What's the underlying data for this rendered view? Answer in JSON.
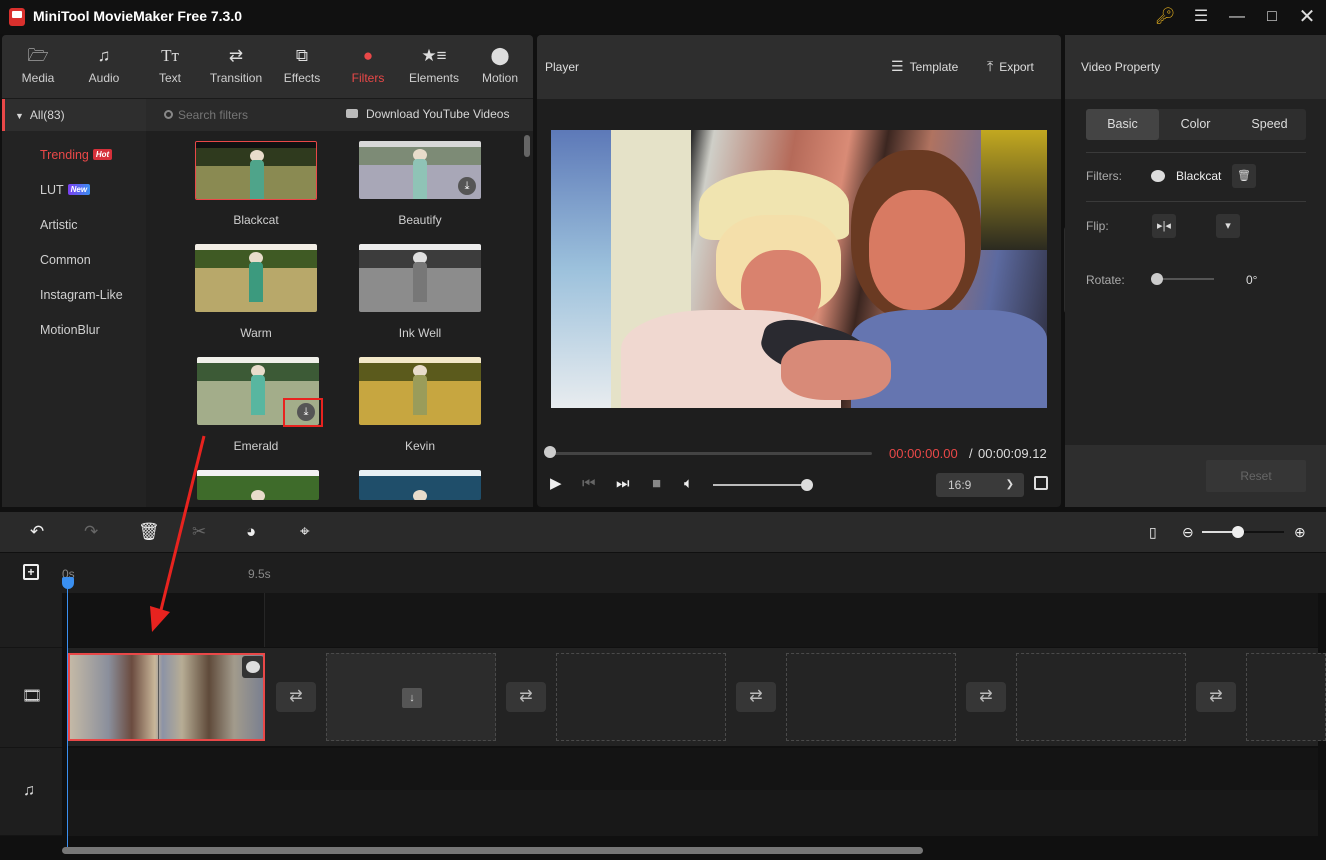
{
  "window": {
    "title": "MiniTool MovieMaker Free 7.3.0",
    "controls": [
      "key-icon",
      "menu-icon",
      "minimize-icon",
      "maximize-icon",
      "close-icon"
    ]
  },
  "main_tabs": [
    {
      "label": "Media",
      "icon": "folder-icon"
    },
    {
      "label": "Audio",
      "icon": "music-note-icon"
    },
    {
      "label": "Text",
      "icon": "text-icon"
    },
    {
      "label": "Transition",
      "icon": "transition-arrows-icon"
    },
    {
      "label": "Effects",
      "icon": "effects-icon"
    },
    {
      "label": "Filters",
      "icon": "filters-icon",
      "active": true
    },
    {
      "label": "Elements",
      "icon": "elements-icon"
    },
    {
      "label": "Motion",
      "icon": "motion-icon"
    }
  ],
  "categories": {
    "all_label": "All(83)",
    "items": [
      {
        "label": "Trending",
        "badge": "Hot",
        "active": true
      },
      {
        "label": "LUT",
        "badge": "New"
      },
      {
        "label": "Artistic"
      },
      {
        "label": "Common"
      },
      {
        "label": "Instagram-Like"
      },
      {
        "label": "MotionBlur"
      }
    ]
  },
  "filter_search": {
    "placeholder": "Search filters",
    "download_youtube_label": "Download YouTube Videos"
  },
  "filters": [
    {
      "name": "Blackcat",
      "selected": true,
      "downloaded": true
    },
    {
      "name": "Beautify",
      "downloaded": false
    },
    {
      "name": "Warm",
      "downloaded": true
    },
    {
      "name": "Ink Well",
      "downloaded": true
    },
    {
      "name": "Emerald",
      "downloaded": false
    },
    {
      "name": "Kevin",
      "downloaded": true
    },
    {
      "name": "",
      "downloaded": true
    },
    {
      "name": "",
      "downloaded": true
    }
  ],
  "player": {
    "title": "Player",
    "template_label": "Template",
    "export_label": "Export",
    "current_time": "00:00:00.00",
    "time_separator": "/",
    "total_time": "00:00:09.12",
    "progress": 0,
    "volume": 1.0,
    "aspect_ratio": "16:9"
  },
  "property": {
    "title": "Video Property",
    "tabs": [
      {
        "label": "Basic",
        "active": true
      },
      {
        "label": "Color"
      },
      {
        "label": "Speed"
      }
    ],
    "filters_label": "Filters:",
    "filter_value": "Blackcat",
    "flip_label": "Flip:",
    "rotate_label": "Rotate:",
    "rotate_value": "0°",
    "reset_label": "Reset"
  },
  "timeline": {
    "ruler_ticks": [
      "0s",
      "9.5s"
    ],
    "zoom_level": 0.42,
    "clips": [
      {
        "type": "video",
        "has_filter": true
      }
    ],
    "empty_slots": 5
  },
  "colors": {
    "accent": "#e94848",
    "playhead": "#3a8ff0",
    "annotation": "#e8231f"
  }
}
